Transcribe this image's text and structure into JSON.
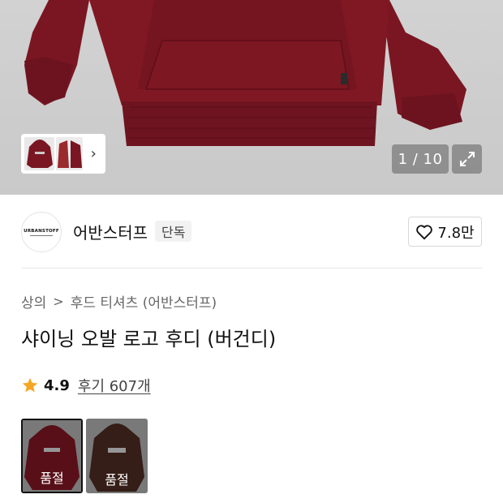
{
  "gallery": {
    "counter": "1 / 10",
    "thumbnail_count": 2
  },
  "brand": {
    "logo_text": "URBANSTOFF",
    "name": "어반스터프",
    "badge": "단독",
    "likes": "7.8만"
  },
  "breadcrumb": {
    "category": "상의",
    "separator": ">",
    "subcategory": "후드 티셔츠 (어반스터프)"
  },
  "product": {
    "title": "샤이닝 오발 로고 후디 (버건디)",
    "rating": "4.9",
    "reviews": "후기 607개"
  },
  "options": [
    {
      "color": "burgundy",
      "status": "품절",
      "selected": true
    },
    {
      "color": "brown",
      "status": "품절",
      "selected": false
    }
  ],
  "colors": {
    "burgundy": "#7a1622",
    "brown": "#4a2a20",
    "star": "#f5a623"
  }
}
